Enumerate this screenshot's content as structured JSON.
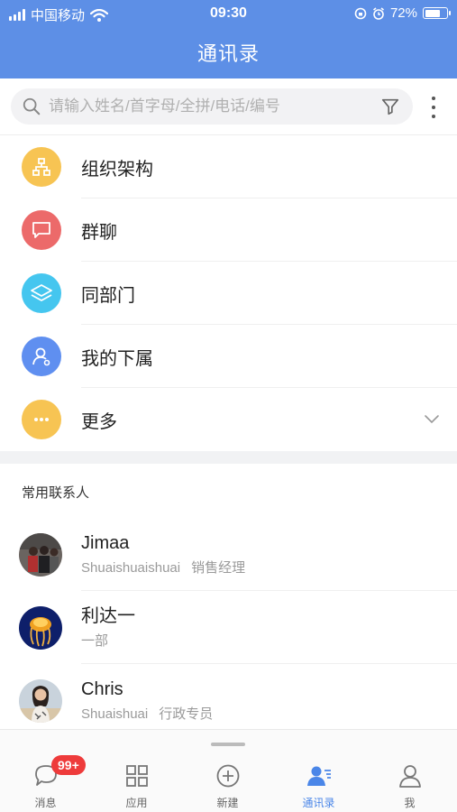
{
  "status_bar": {
    "carrier": "中国移动",
    "time": "09:30",
    "battery": "72%",
    "battery_level": 0.72
  },
  "header": {
    "title": "通讯录"
  },
  "search": {
    "placeholder": "请输入姓名/首字母/全拼/电话/编号"
  },
  "menu": [
    {
      "label": "组织架构",
      "icon": "org-chart-icon",
      "color": "#f7c453"
    },
    {
      "label": "群聊",
      "icon": "chat-icon",
      "color": "#ec6a6a"
    },
    {
      "label": "同部门",
      "icon": "layers-icon",
      "color": "#45c6ef"
    },
    {
      "label": "我的下属",
      "icon": "subordinate-icon",
      "color": "#5f8ff0"
    },
    {
      "label": "更多",
      "icon": "more-dots-icon",
      "color": "#f7c453"
    }
  ],
  "section_title": "常用联系人",
  "contacts": [
    {
      "name": "Jimaa",
      "sub1": "Shuaishuaishuai",
      "sub2": "销售经理"
    },
    {
      "name": "利达一",
      "sub1": "一部",
      "sub2": ""
    },
    {
      "name": "Chris",
      "sub1": "Shuaishuai",
      "sub2": "行政专员"
    }
  ],
  "tabs": [
    {
      "label": "消息",
      "icon": "message-icon",
      "badge": "99+"
    },
    {
      "label": "应用",
      "icon": "apps-grid-icon"
    },
    {
      "label": "新建",
      "icon": "add-circle-icon"
    },
    {
      "label": "通讯录",
      "icon": "contacts-icon",
      "active": true
    },
    {
      "label": "我",
      "icon": "profile-icon"
    }
  ],
  "colors": {
    "accent": "#5d8fe6",
    "badge": "#ee3b3b"
  }
}
